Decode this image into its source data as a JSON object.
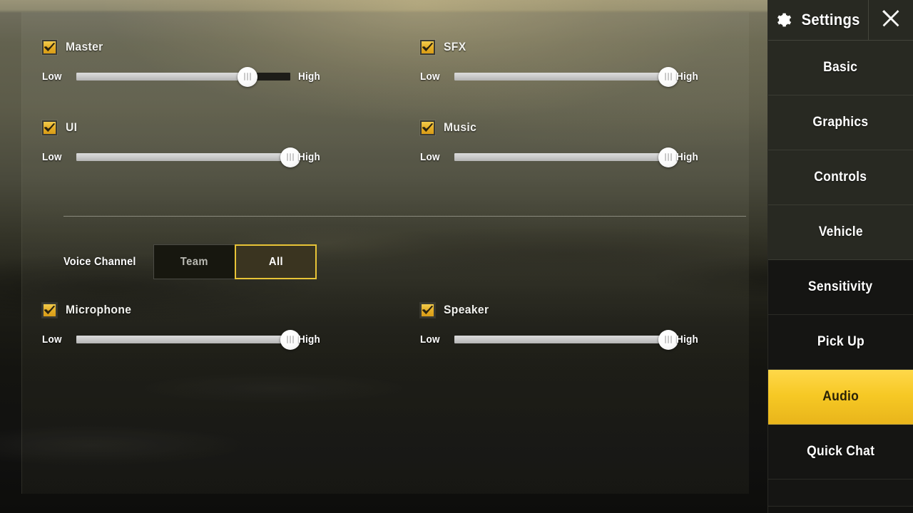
{
  "header": {
    "title": "Settings",
    "gear_icon": "gear-icon",
    "close_icon": "close-x-icon"
  },
  "sidebar": {
    "items": [
      {
        "label": "Basic",
        "active": false
      },
      {
        "label": "Graphics",
        "active": false
      },
      {
        "label": "Controls",
        "active": false
      },
      {
        "label": "Vehicle",
        "active": false
      },
      {
        "label": "Sensitivity",
        "active": false
      },
      {
        "label": "Pick Up",
        "active": false
      },
      {
        "label": "Audio",
        "active": true
      },
      {
        "label": "Quick Chat",
        "active": false
      }
    ],
    "active_label": "Audio",
    "active_color": "#f6c824"
  },
  "audio": {
    "low_label": "Low",
    "high_label": "High",
    "rows": [
      {
        "name": "Master",
        "checked": true,
        "value": 80,
        "column": "left",
        "index": 0
      },
      {
        "name": "SFX",
        "checked": true,
        "value": 100,
        "column": "right",
        "index": 0
      },
      {
        "name": "UI",
        "checked": true,
        "value": 100,
        "column": "left",
        "index": 1
      },
      {
        "name": "Music",
        "checked": true,
        "value": 100,
        "column": "right",
        "index": 1
      },
      {
        "name": "Microphone",
        "checked": true,
        "value": 100,
        "column": "left",
        "index": 2
      },
      {
        "name": "Speaker",
        "checked": true,
        "value": 100,
        "column": "right",
        "index": 2
      }
    ]
  },
  "voice_channel": {
    "label": "Voice Channel",
    "options": [
      {
        "label": "Team",
        "selected": false
      },
      {
        "label": "All",
        "selected": true
      }
    ],
    "selected": "All",
    "selected_border_color": "#e8c437"
  },
  "colors": {
    "accent": "#f6c824",
    "checkbox": "#e3ab24",
    "track_fill": "#c6c6c6",
    "track_empty": "#1d1c18"
  }
}
